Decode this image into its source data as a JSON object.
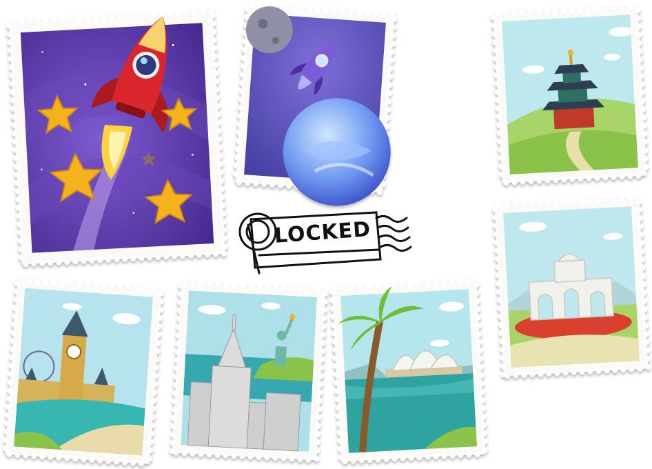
{
  "stamp_label": "LOCKED",
  "colors": {
    "stamp_paper": "#fbfaf6",
    "space_purple": "#5b3aa6",
    "sky_blue": "#9fe0ea",
    "grass_green": "#8bc34a",
    "sea_teal": "#38b6b0",
    "rocket_red": "#d9262c",
    "star_gold": "#f6b21c",
    "ink": "#111111"
  },
  "stamps": [
    {
      "id": "rocket-stars",
      "icon": "rocket-icon"
    },
    {
      "id": "space-planet",
      "icon": "planet-icon"
    },
    {
      "id": "temple-of-heaven",
      "icon": "pagoda-icon"
    },
    {
      "id": "alcala-gate",
      "icon": "gate-icon"
    },
    {
      "id": "big-ben-london",
      "icon": "clock-tower-icon"
    },
    {
      "id": "new-york-statue",
      "icon": "statue-of-liberty-icon"
    },
    {
      "id": "sydney-opera",
      "icon": "opera-house-icon"
    }
  ]
}
